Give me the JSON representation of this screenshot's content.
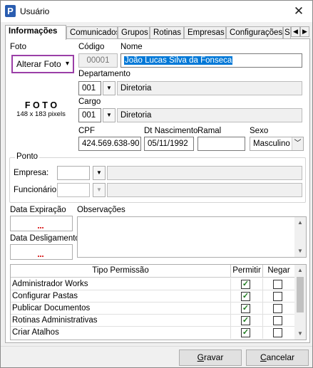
{
  "window": {
    "title": "Usuário",
    "app_icon_letter": "P",
    "close_glyph": "✕"
  },
  "tabs": [
    {
      "label": "Informações",
      "active": true
    },
    {
      "label": "Comunicados",
      "active": false
    },
    {
      "label": "Grupos",
      "active": false
    },
    {
      "label": "Rotinas",
      "active": false
    },
    {
      "label": "Empresas",
      "active": false
    },
    {
      "label": "Configurações",
      "active": false
    },
    {
      "label": "S",
      "active": false
    }
  ],
  "tab_scroll": {
    "left_glyph": "◀",
    "right_glyph": "▶"
  },
  "photo": {
    "label": "Foto",
    "button_label": "Alterar Foto",
    "button_arrow": "▾",
    "placeholder_title": "F O T O",
    "placeholder_size": "148 x 183 pixels"
  },
  "codigo": {
    "label": "Código",
    "value": "00001"
  },
  "nome": {
    "label": "Nome",
    "value": "João Lucas Silva da Fonseca"
  },
  "departamento": {
    "label": "Departamento",
    "code": "001",
    "name": "Diretoria"
  },
  "cargo": {
    "label": "Cargo",
    "code": "001",
    "name": "Diretoria"
  },
  "cpf": {
    "label": "CPF",
    "value": "424.569.638-90"
  },
  "nascimento": {
    "label": "Dt Nascimento",
    "value": "05/11/1992"
  },
  "ramal": {
    "label": "Ramal",
    "value": ""
  },
  "sexo": {
    "label": "Sexo",
    "value": "Masculino",
    "arrow": "﹀"
  },
  "ponto": {
    "label": "Ponto",
    "empresa_label": "Empresa:",
    "funcionario_label": "Funcionário:"
  },
  "expiracao": {
    "label": "Data Expiração"
  },
  "desligamento": {
    "label": "Data Desligamento"
  },
  "observacoes": {
    "label": "Observações"
  },
  "permissions": {
    "headers": [
      "Tipo Permissão",
      "Permitir",
      "Negar"
    ],
    "rows": [
      {
        "name": "Administrador Works",
        "permitir": true,
        "negar": false
      },
      {
        "name": "Configurar Pastas",
        "permitir": true,
        "negar": false
      },
      {
        "name": "Publicar Documentos",
        "permitir": true,
        "negar": false
      },
      {
        "name": "Rotinas Administrativas",
        "permitir": true,
        "negar": false
      },
      {
        "name": "Criar Atalhos",
        "permitir": true,
        "negar": false
      }
    ]
  },
  "scroll_glyphs": {
    "up": "▲",
    "down": "▼"
  },
  "dropdown_glyph": "▼",
  "buttons": {
    "save_prefix": "",
    "save_underlined": "G",
    "save_rest": "ravar",
    "cancel_prefix": "",
    "cancel_underlined": "C",
    "cancel_rest": "ancelar"
  },
  "colors": {
    "selection": "#0078d7",
    "photo_button_border": "#9b3fa7",
    "check": "#1d7a1d"
  }
}
